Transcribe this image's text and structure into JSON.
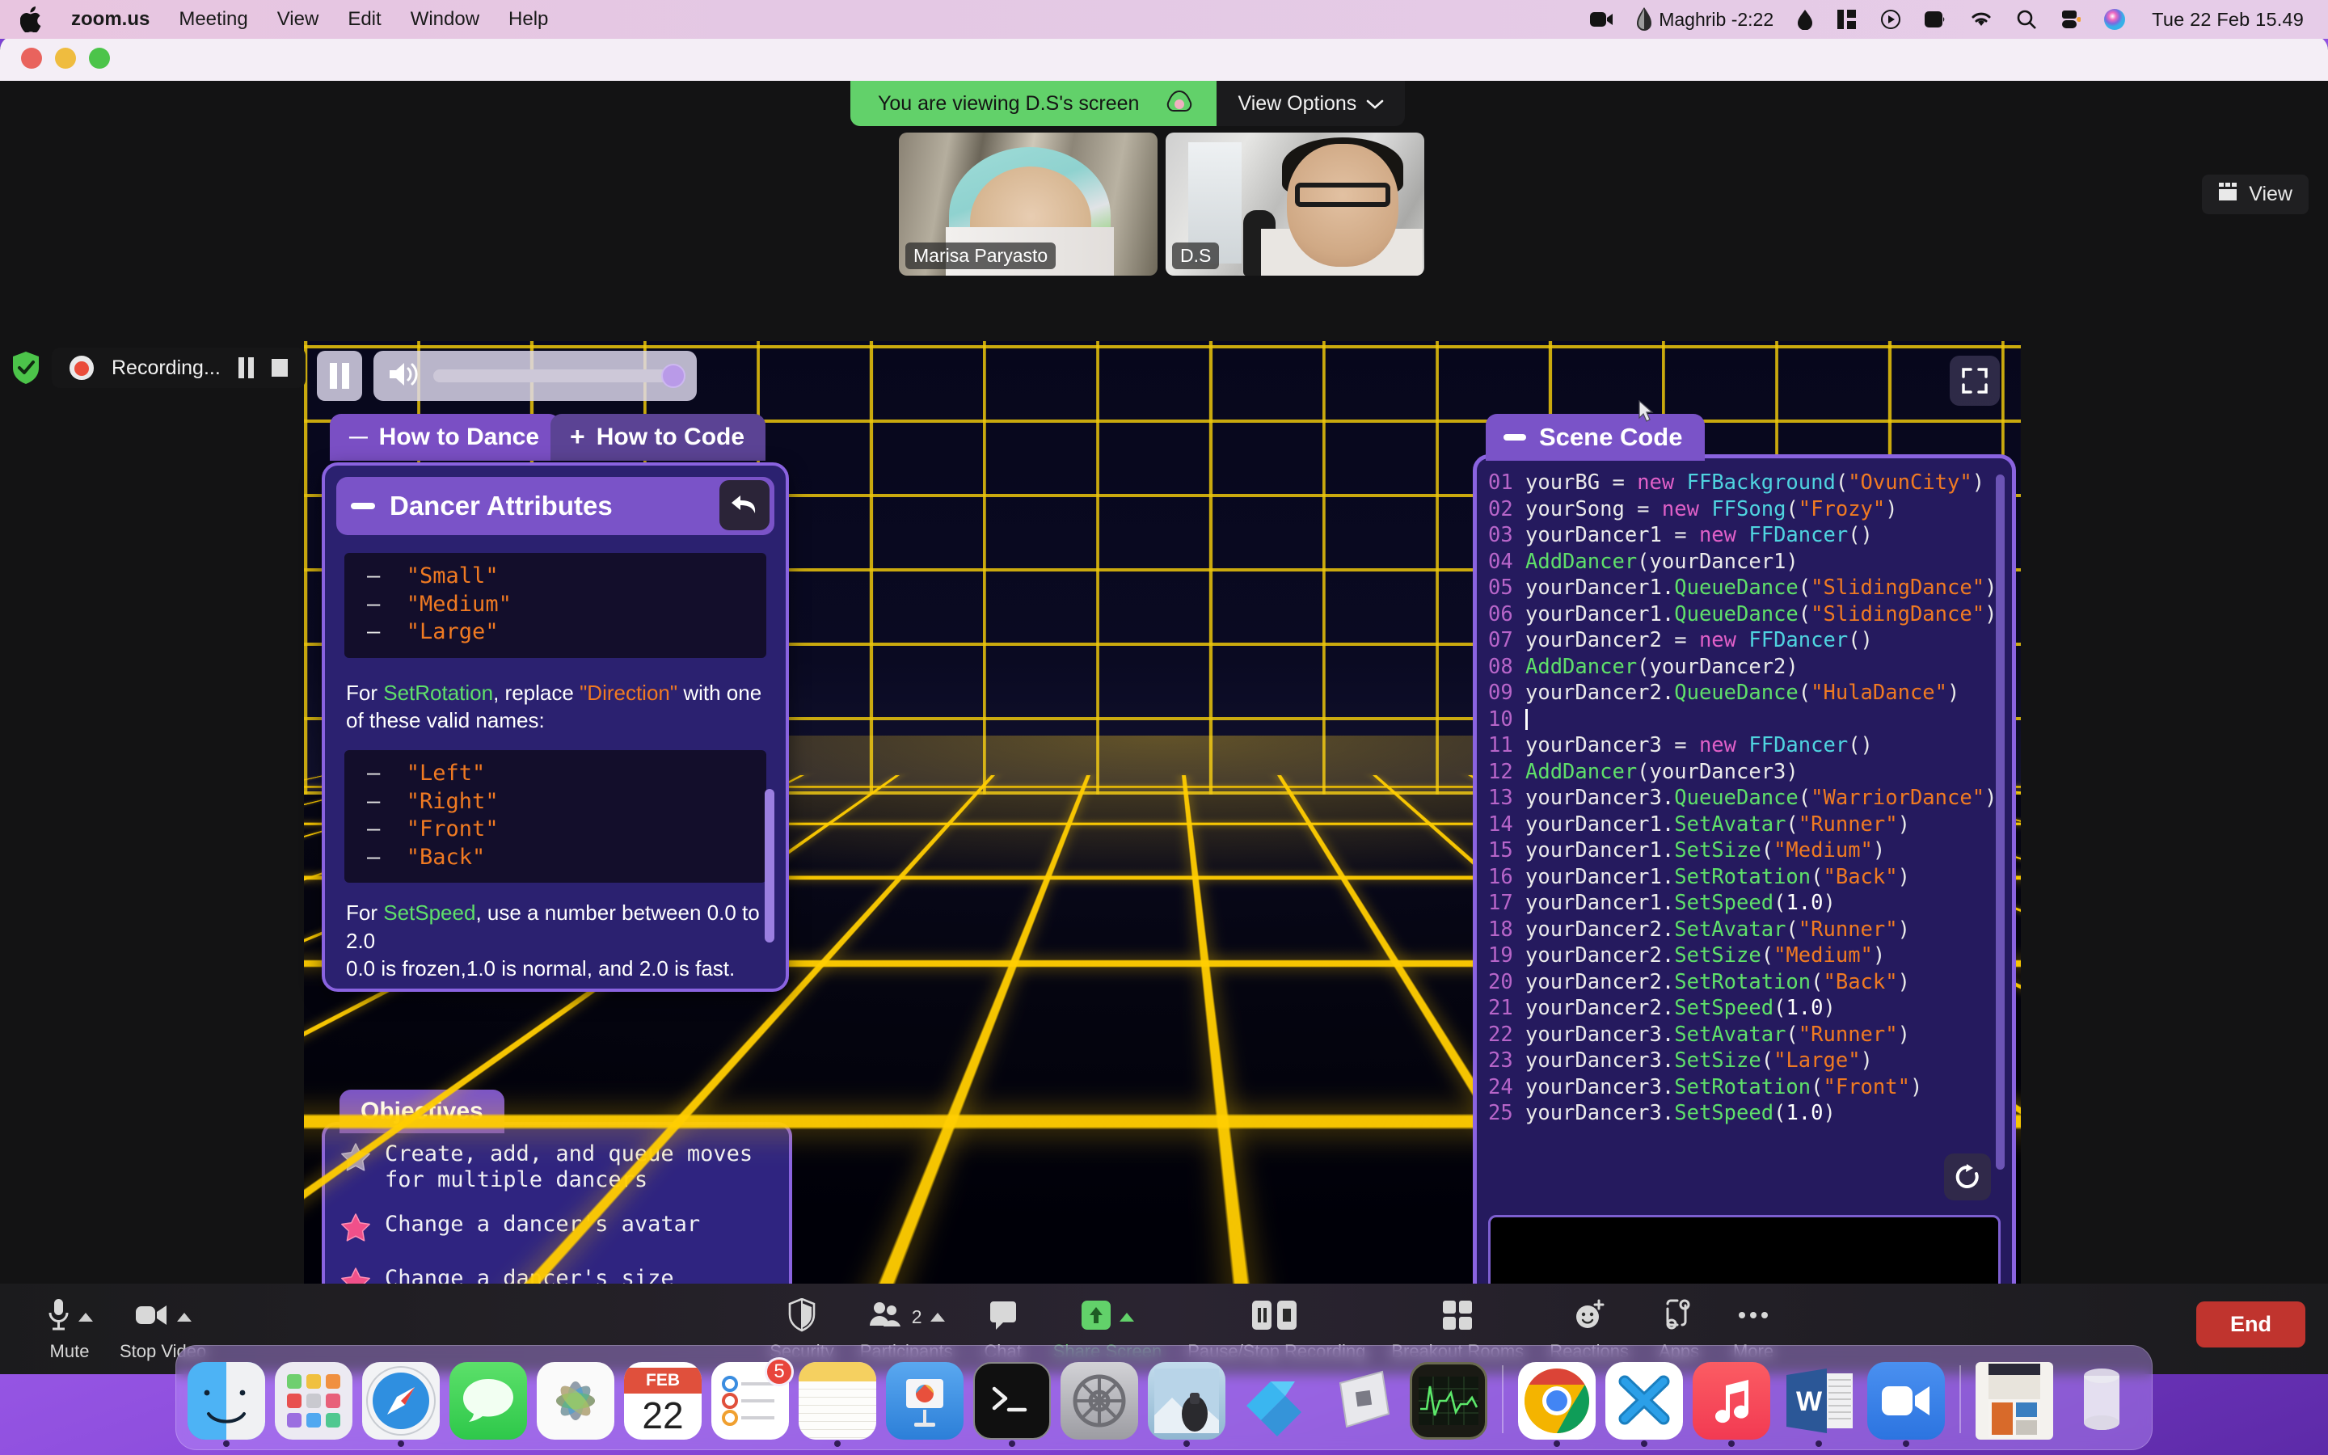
{
  "menubar": {
    "apple_icon": "apple-logo-icon",
    "app_name": "zoom.us",
    "items": [
      "Meeting",
      "View",
      "Edit",
      "Window",
      "Help"
    ],
    "status_icons": [
      "camera-icon",
      "prayer-time-icon",
      "stats-icon",
      "media-play-icon",
      "display-icon",
      "wifi-icon",
      "search-icon",
      "control-center-icon",
      "siri-icon"
    ],
    "prayer_time": "Maghrib -2:22",
    "clock": "Tue 22 Feb  15.49"
  },
  "zoom_window": {
    "banner": {
      "text": "You are viewing D.S's screen",
      "cloud_icon": "cloud-icon",
      "view_options_label": "View Options",
      "chevron_icon": "chevron-down-icon"
    },
    "view_button": {
      "label": "View",
      "icon": "layout-grid-icon"
    },
    "recording": {
      "shield_icon": "shield-check-icon",
      "label": "Recording...",
      "pause_icon": "pause-icon",
      "stop_icon": "stop-icon"
    },
    "participants_thumbs": [
      {
        "name": "Marisa Paryasto"
      },
      {
        "name": "D.S"
      }
    ]
  },
  "shared_screen": {
    "media_controls": {
      "pause_icon": "pause-icon",
      "speaker_icon": "speaker-icon",
      "volume_percent": 100,
      "fullscreen_icon": "fullscreen-icon"
    },
    "tabs": [
      {
        "label": "How to Dance",
        "sign": "—",
        "active": true
      },
      {
        "label": "How to Code",
        "sign": "+",
        "active": false
      }
    ],
    "dancer_attributes": {
      "title": "Dancer Attributes",
      "collapse_icon": "minimize-icon",
      "undo_icon": "undo-arrow-icon",
      "sizes": [
        "\"Small\"",
        "\"Medium\"",
        "\"Large\""
      ],
      "rotation_intro_prefix": "For ",
      "rotation_intro_fn": "SetRotation",
      "rotation_intro_mid": ", replace ",
      "rotation_intro_param": "\"Direction\"",
      "rotation_intro_suffix": " with one of these valid names:",
      "directions": [
        "\"Left\"",
        "\"Right\"",
        "\"Front\"",
        "\"Back\""
      ],
      "speed_prefix": "For ",
      "speed_fn": "SetSpeed",
      "speed_suffix": ", use a number between 0.0 to 2.0",
      "speed_note": "0.0 is frozen,1.0 is normal, and 2.0 is fast."
    },
    "objectives": {
      "title": "Objectives",
      "items": [
        {
          "text": "Create, add, and queue moves for multiple dancers",
          "done": false
        },
        {
          "text": "Change a dancer's avatar",
          "done": true
        },
        {
          "text": "Change a dancer's size",
          "done": true
        }
      ]
    },
    "scene_code": {
      "title": "Scene Code",
      "collapse_icon": "minimize-icon",
      "refresh_icon": "refresh-icon",
      "lines": [
        {
          "n": "01",
          "tokens": [
            [
              "var",
              "yourBG "
            ],
            [
              "punc",
              "= "
            ],
            [
              "kw",
              "new "
            ],
            [
              "cls",
              "FFBackground"
            ],
            [
              "punc",
              "("
            ],
            [
              "str",
              "\"OvunCity\""
            ],
            [
              "punc",
              ")"
            ]
          ]
        },
        {
          "n": "02",
          "tokens": [
            [
              "var",
              "yourSong "
            ],
            [
              "punc",
              "= "
            ],
            [
              "kw",
              "new "
            ],
            [
              "cls",
              "FFSong"
            ],
            [
              "punc",
              "("
            ],
            [
              "str",
              "\"Frozy\""
            ],
            [
              "punc",
              ")"
            ]
          ]
        },
        {
          "n": "03",
          "tokens": [
            [
              "var",
              "yourDancer1 "
            ],
            [
              "punc",
              "= "
            ],
            [
              "kw",
              "new "
            ],
            [
              "cls",
              "FFDancer"
            ],
            [
              "punc",
              "()"
            ]
          ]
        },
        {
          "n": "04",
          "tokens": [
            [
              "fn",
              "AddDancer"
            ],
            [
              "punc",
              "("
            ],
            [
              "var",
              "yourDancer1"
            ],
            [
              "punc",
              ")"
            ]
          ]
        },
        {
          "n": "05",
          "tokens": [
            [
              "var",
              "yourDancer1"
            ],
            [
              "punc",
              "."
            ],
            [
              "fn",
              "QueueDance"
            ],
            [
              "punc",
              "("
            ],
            [
              "str",
              "\"SlidingDance\""
            ],
            [
              "punc",
              ")"
            ]
          ]
        },
        {
          "n": "06",
          "tokens": [
            [
              "var",
              "yourDancer1"
            ],
            [
              "punc",
              "."
            ],
            [
              "fn",
              "QueueDance"
            ],
            [
              "punc",
              "("
            ],
            [
              "str",
              "\"SlidingDance\""
            ],
            [
              "punc",
              ")"
            ]
          ]
        },
        {
          "n": "07",
          "tokens": [
            [
              "var",
              "yourDancer2 "
            ],
            [
              "punc",
              "= "
            ],
            [
              "kw",
              "new "
            ],
            [
              "cls",
              "FFDancer"
            ],
            [
              "punc",
              "()"
            ]
          ]
        },
        {
          "n": "08",
          "tokens": [
            [
              "fn",
              "AddDancer"
            ],
            [
              "punc",
              "("
            ],
            [
              "var",
              "yourDancer2"
            ],
            [
              "punc",
              ")"
            ]
          ]
        },
        {
          "n": "09",
          "tokens": [
            [
              "var",
              "yourDancer2"
            ],
            [
              "punc",
              "."
            ],
            [
              "fn",
              "QueueDance"
            ],
            [
              "punc",
              "("
            ],
            [
              "str",
              "\"HulaDance\""
            ],
            [
              "punc",
              ")"
            ]
          ]
        },
        {
          "n": "10",
          "tokens": [
            [
              "caret",
              ""
            ]
          ]
        },
        {
          "n": "11",
          "tokens": [
            [
              "var",
              "yourDancer3 "
            ],
            [
              "punc",
              "= "
            ],
            [
              "kw",
              "new "
            ],
            [
              "cls",
              "FFDancer"
            ],
            [
              "punc",
              "()"
            ]
          ]
        },
        {
          "n": "12",
          "tokens": [
            [
              "fn",
              "AddDancer"
            ],
            [
              "punc",
              "("
            ],
            [
              "var",
              "yourDancer3"
            ],
            [
              "punc",
              ")"
            ]
          ]
        },
        {
          "n": "13",
          "tokens": [
            [
              "var",
              "yourDancer3"
            ],
            [
              "punc",
              "."
            ],
            [
              "fn",
              "QueueDance"
            ],
            [
              "punc",
              "("
            ],
            [
              "str",
              "\"WarriorDance\""
            ],
            [
              "punc",
              ")"
            ]
          ]
        },
        {
          "n": "14",
          "tokens": [
            [
              "var",
              "yourDancer1"
            ],
            [
              "punc",
              "."
            ],
            [
              "fn",
              "SetAvatar"
            ],
            [
              "punc",
              "("
            ],
            [
              "str",
              "\"Runner\""
            ],
            [
              "punc",
              ")"
            ]
          ]
        },
        {
          "n": "15",
          "tokens": [
            [
              "var",
              "yourDancer1"
            ],
            [
              "punc",
              "."
            ],
            [
              "fn",
              "SetSize"
            ],
            [
              "punc",
              "("
            ],
            [
              "str",
              "\"Medium\""
            ],
            [
              "punc",
              ")"
            ]
          ]
        },
        {
          "n": "16",
          "tokens": [
            [
              "var",
              "yourDancer1"
            ],
            [
              "punc",
              "."
            ],
            [
              "fn",
              "SetRotation"
            ],
            [
              "punc",
              "("
            ],
            [
              "str",
              "\"Back\""
            ],
            [
              "punc",
              ")"
            ]
          ]
        },
        {
          "n": "17",
          "tokens": [
            [
              "var",
              "yourDancer1"
            ],
            [
              "punc",
              "."
            ],
            [
              "fn",
              "SetSpeed"
            ],
            [
              "punc",
              "("
            ],
            [
              "num",
              "1.0"
            ],
            [
              "punc",
              ")"
            ]
          ]
        },
        {
          "n": "18",
          "tokens": [
            [
              "var",
              "yourDancer2"
            ],
            [
              "punc",
              "."
            ],
            [
              "fn",
              "SetAvatar"
            ],
            [
              "punc",
              "("
            ],
            [
              "str",
              "\"Runner\""
            ],
            [
              "punc",
              ")"
            ]
          ]
        },
        {
          "n": "19",
          "tokens": [
            [
              "var",
              "yourDancer2"
            ],
            [
              "punc",
              "."
            ],
            [
              "fn",
              "SetSize"
            ],
            [
              "punc",
              "("
            ],
            [
              "str",
              "\"Medium\""
            ],
            [
              "punc",
              ")"
            ]
          ]
        },
        {
          "n": "20",
          "tokens": [
            [
              "var",
              "yourDancer2"
            ],
            [
              "punc",
              "."
            ],
            [
              "fn",
              "SetRotation"
            ],
            [
              "punc",
              "("
            ],
            [
              "str",
              "\"Back\""
            ],
            [
              "punc",
              ")"
            ]
          ]
        },
        {
          "n": "21",
          "tokens": [
            [
              "var",
              "yourDancer2"
            ],
            [
              "punc",
              "."
            ],
            [
              "fn",
              "SetSpeed"
            ],
            [
              "punc",
              "("
            ],
            [
              "num",
              "1.0"
            ],
            [
              "punc",
              ")"
            ]
          ]
        },
        {
          "n": "22",
          "tokens": [
            [
              "var",
              "yourDancer3"
            ],
            [
              "punc",
              "."
            ],
            [
              "fn",
              "SetAvatar"
            ],
            [
              "punc",
              "("
            ],
            [
              "str",
              "\"Runner\""
            ],
            [
              "punc",
              ")"
            ]
          ]
        },
        {
          "n": "23",
          "tokens": [
            [
              "var",
              "yourDancer3"
            ],
            [
              "punc",
              "."
            ],
            [
              "fn",
              "SetSize"
            ],
            [
              "punc",
              "("
            ],
            [
              "str",
              "\"Large\""
            ],
            [
              "punc",
              ")"
            ]
          ]
        },
        {
          "n": "24",
          "tokens": [
            [
              "var",
              "yourDancer3"
            ],
            [
              "punc",
              "."
            ],
            [
              "fn",
              "SetRotation"
            ],
            [
              "punc",
              "("
            ],
            [
              "str",
              "\"Front\""
            ],
            [
              "punc",
              ")"
            ]
          ]
        },
        {
          "n": "25",
          "tokens": [
            [
              "var",
              "yourDancer3"
            ],
            [
              "punc",
              "."
            ],
            [
              "fn",
              "SetSpeed"
            ],
            [
              "punc",
              "("
            ],
            [
              "num",
              "1.0"
            ],
            [
              "punc",
              ")"
            ]
          ]
        }
      ]
    }
  },
  "toolbar": {
    "items": [
      {
        "label": "Mute",
        "icon": "microphone-icon",
        "caret": true
      },
      {
        "label": "Stop Video",
        "icon": "video-camera-icon",
        "caret": true
      },
      {
        "label": "Security",
        "icon": "shield-icon",
        "caret": false
      },
      {
        "label": "Participants",
        "icon": "people-icon",
        "caret": true,
        "count": "2"
      },
      {
        "label": "Chat",
        "icon": "chat-bubble-icon",
        "caret": false
      },
      {
        "label": "Share Screen",
        "icon": "share-up-arrow-icon",
        "caret": true,
        "highlight": true
      },
      {
        "label": "Pause/Stop Recording",
        "icon": "pause-stop-icon",
        "caret": false
      },
      {
        "label": "Breakout Rooms",
        "icon": "grid-squares-icon",
        "caret": false
      },
      {
        "label": "Reactions",
        "icon": "smiley-plus-icon",
        "caret": false
      },
      {
        "label": "Apps",
        "icon": "apps-icon",
        "caret": false
      },
      {
        "label": "More",
        "icon": "ellipsis-icon",
        "caret": false
      }
    ],
    "end_button": "End"
  },
  "dock": {
    "items": [
      {
        "name": "finder",
        "running": true
      },
      {
        "name": "launchpad",
        "running": false
      },
      {
        "name": "safari",
        "running": true
      },
      {
        "name": "messages",
        "running": false
      },
      {
        "name": "photos",
        "running": false
      },
      {
        "name": "calendar",
        "running": false,
        "month": "FEB",
        "day": "22"
      },
      {
        "name": "reminders",
        "running": false,
        "badge": "5"
      },
      {
        "name": "notes",
        "running": true
      },
      {
        "name": "keynote",
        "running": false
      },
      {
        "name": "terminal",
        "running": true
      },
      {
        "name": "system-preferences",
        "running": false
      },
      {
        "name": "app-store-photos",
        "running": true
      },
      {
        "name": "blender",
        "running": false
      },
      {
        "name": "roblox-studio",
        "running": false
      },
      {
        "name": "activity-monitor",
        "running": false
      },
      {
        "name": "chrome",
        "running": true
      },
      {
        "name": "vscode",
        "running": true
      },
      {
        "name": "music",
        "running": true
      },
      {
        "name": "word",
        "running": true
      },
      {
        "name": "zoom",
        "running": true
      },
      {
        "name": "document-preview",
        "running": false
      },
      {
        "name": "trash",
        "running": false
      }
    ]
  },
  "colors": {
    "accent_purple": "#7a53c8",
    "panel_bg": "#2b2170",
    "panel_border": "#8a63e0",
    "grid_yellow": "#ffcd00",
    "banner_green": "#62d16a",
    "end_red": "#c0342e",
    "code_string": "#f07a22",
    "code_fn": "#5fe06a",
    "code_class": "#4fd4e0",
    "code_keyword": "#e060c8",
    "code_linenum": "#b765c9"
  }
}
